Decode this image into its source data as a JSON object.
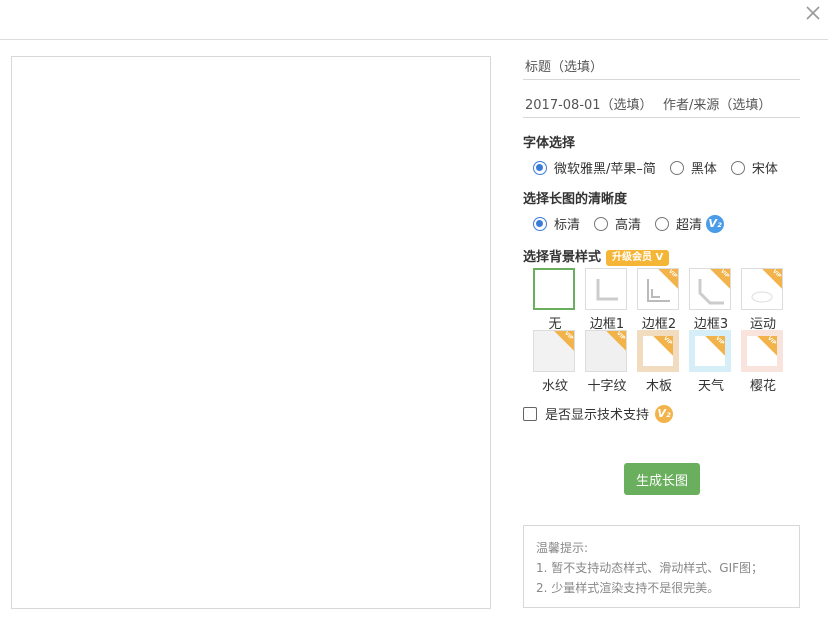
{
  "header": {
    "close_icon": "close-icon"
  },
  "form": {
    "title_placeholder": "标题（选填）",
    "date_placeholder": "2017-08-01（选填）",
    "author_placeholder": "作者/来源（选填）"
  },
  "font": {
    "title": "字体选择",
    "options": [
      "微软雅黑/苹果–简",
      "黑体",
      "宋体"
    ],
    "selected": "微软雅黑/苹果–简"
  },
  "clarity": {
    "title": "选择长图的清晰度",
    "options": [
      "标清",
      "高清",
      "超清"
    ],
    "selected": "标清",
    "v_badge": "V₂",
    "v_badge_color": "#4a9be8"
  },
  "background": {
    "title": "选择背景样式",
    "upgrade_label": "升级会员 V",
    "vip_tag": "VIP",
    "items": [
      {
        "label": "无",
        "selected": true,
        "vip": false
      },
      {
        "label": "边框1",
        "vip": false
      },
      {
        "label": "边框2",
        "vip": true
      },
      {
        "label": "边框3",
        "vip": true
      },
      {
        "label": "运动",
        "vip": true
      },
      {
        "label": "水纹",
        "vip": true
      },
      {
        "label": "十字纹",
        "vip": true
      },
      {
        "label": "木板",
        "vip": true
      },
      {
        "label": "天气",
        "vip": true
      },
      {
        "label": "樱花",
        "vip": true
      }
    ]
  },
  "tech_support": {
    "label": "是否显示技术支持",
    "checked": false,
    "v_badge": "V₂",
    "v_badge_color": "#f2b34a"
  },
  "generate_button": "生成长图",
  "tips": {
    "title": "温馨提示:",
    "line1": "1. 暂不支持动态样式、滑动样式、GIF图；",
    "line2": "2. 少量样式渲染支持不是很完美。"
  },
  "colors": {
    "accent_green": "#6aaf5e",
    "radio_blue": "#3a7bd5",
    "vip_gold": "#f5b536"
  }
}
